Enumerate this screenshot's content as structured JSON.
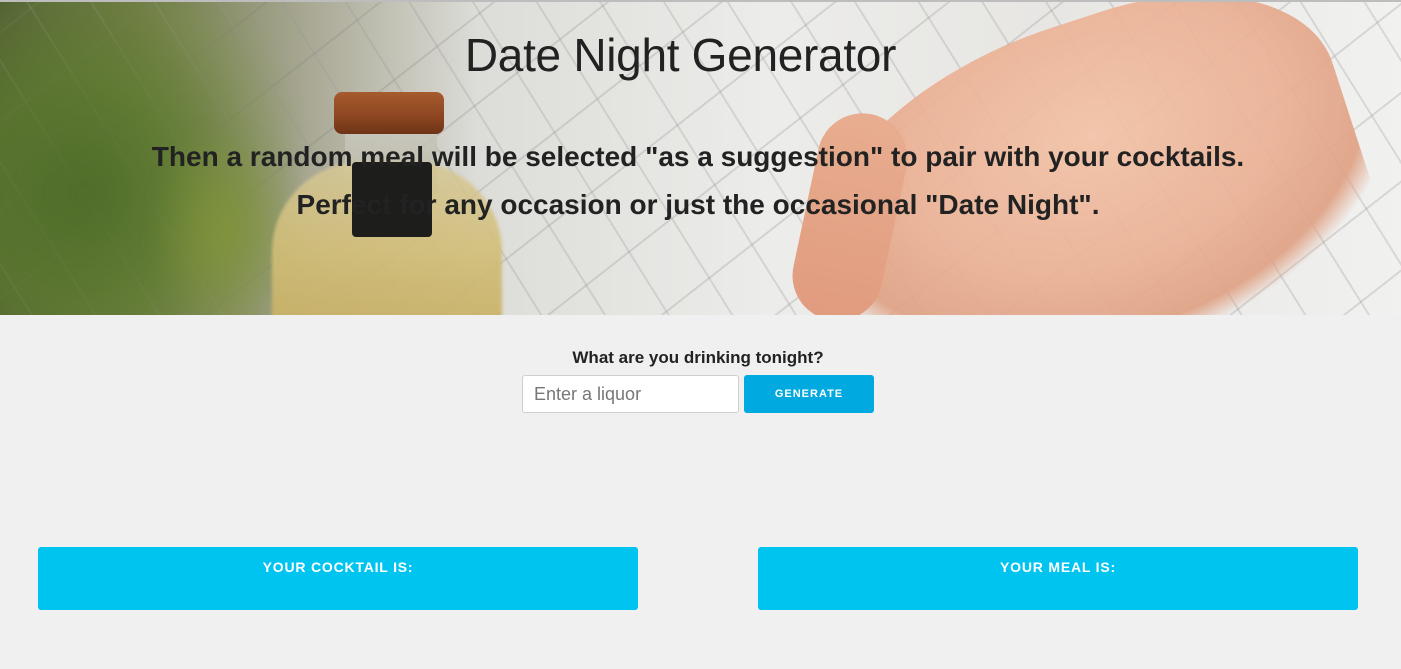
{
  "hero": {
    "title": "Date Night Generator",
    "line1": "Then a random meal will be selected \"as a suggestion\" to pair with your cocktails.",
    "line2": "Perfect for any occasion or just the occasional \"Date Night\"."
  },
  "form": {
    "label": "What are you drinking tonight?",
    "input_placeholder": "Enter a liquor",
    "input_value": "",
    "button_label": "GENERATE"
  },
  "results": {
    "cocktail_label": "YOUR COCKTAIL IS:",
    "meal_label": "YOUR MEAL IS:"
  },
  "colors": {
    "page_background": "#f0f0f0",
    "button": "#00a9e0",
    "result_card": "#00c4f0",
    "text": "#222222"
  }
}
